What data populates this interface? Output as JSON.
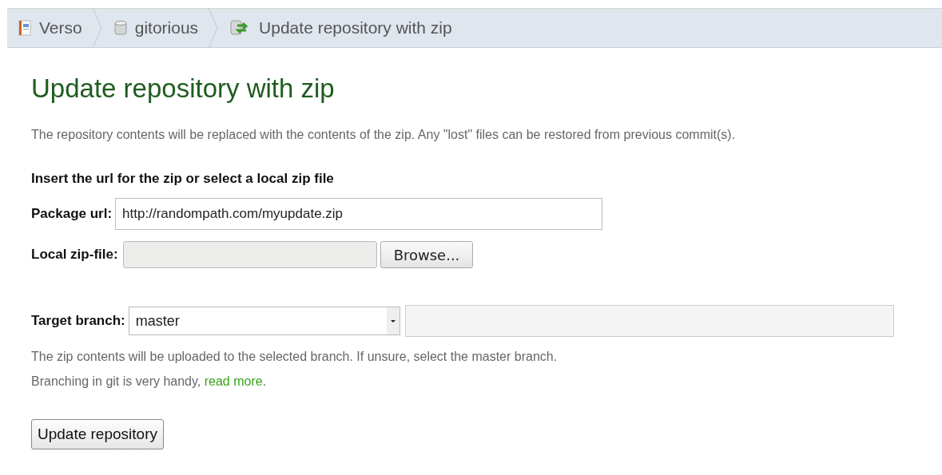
{
  "breadcrumbs": [
    {
      "label": "Verso",
      "kind": "notebook"
    },
    {
      "label": "gitorious",
      "kind": "database"
    },
    {
      "label": "Update repository with zip",
      "kind": "sync"
    }
  ],
  "title": "Update repository with zip",
  "description": "The repository contents will be replaced with the contents of the zip. Any \"lost\" files can be restored from previous commit(s).",
  "section_heading": "Insert the url for the zip or select a local zip file",
  "package_url": {
    "label": "Package url:",
    "value": "http://randompath.com/myupdate.zip"
  },
  "local_file": {
    "label": "Local zip-file:",
    "button": "Browse..."
  },
  "target_branch": {
    "label": "Target branch:",
    "value": "master"
  },
  "help_line": "The zip contents will be uploaded to the selected branch. If unsure, select the master branch.",
  "branch_note": {
    "text": "Branching in git is very handy, ",
    "link": "read more",
    "after": "."
  },
  "submit": "Update repository"
}
